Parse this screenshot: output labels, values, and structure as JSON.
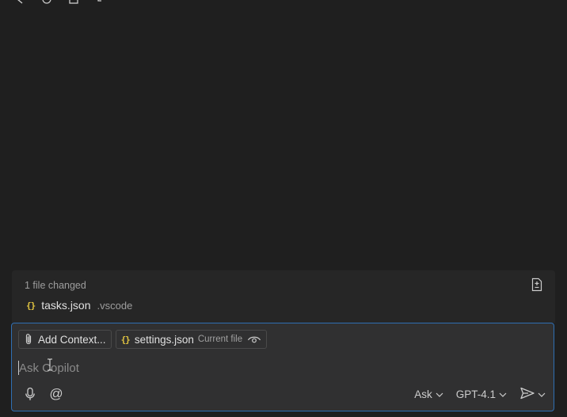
{
  "toolbar": {
    "icons": [
      "back-icon",
      "history-icon",
      "save-icon",
      "tool-icon"
    ]
  },
  "changes": {
    "header": "1 file changed",
    "header_button_icon": "diff-file-icon",
    "files": [
      {
        "icon": "json-braces-icon",
        "icon_text": "{}",
        "name": "tasks.json",
        "dir": ".vscode"
      }
    ]
  },
  "chat": {
    "add_context_label": "Add Context...",
    "current_file_chip": {
      "icon_text": "{}",
      "name": "settings.json",
      "tag": "Current file"
    },
    "prompt_placeholder": "Ask Copilot",
    "prompt_value": "",
    "mode_label": "Ask",
    "model_label": "GPT-4.1"
  },
  "colors": {
    "background": "#1f1f1f",
    "panel": "#262626",
    "input_bg": "#303031",
    "focus_border": "#2f6fb3",
    "json_icon": "#e2c541"
  }
}
